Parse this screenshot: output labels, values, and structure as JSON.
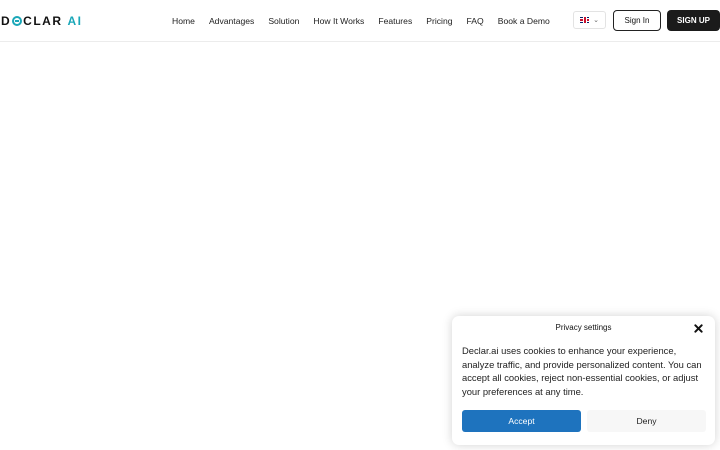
{
  "brand": {
    "logo_prefix": "D",
    "logo_suffix": "CLAR",
    "logo_ai": "AI",
    "accent_color": "#1aa7b8"
  },
  "nav": {
    "items": [
      {
        "label": "Home"
      },
      {
        "label": "Advantages"
      },
      {
        "label": "Solution"
      },
      {
        "label": "How It Works"
      },
      {
        "label": "Features"
      },
      {
        "label": "Pricing"
      },
      {
        "label": "FAQ"
      },
      {
        "label": "Book a Demo"
      }
    ]
  },
  "language": {
    "flag_icon": "uk-flag-icon",
    "chevron_icon": "chevron-down-icon"
  },
  "auth": {
    "sign_in_label": "Sign In",
    "sign_up_label": "SIGN UP"
  },
  "cookie_banner": {
    "title": "Privacy settings",
    "body": "Declar.ai uses cookies to enhance your experience, analyze traffic, and provide personalized content. You can accept all cookies, reject non-essential cookies, or adjust your preferences at any time.",
    "accept_label": "Accept",
    "deny_label": "Deny",
    "accept_color": "#1e73be",
    "close_icon": "close-icon"
  }
}
